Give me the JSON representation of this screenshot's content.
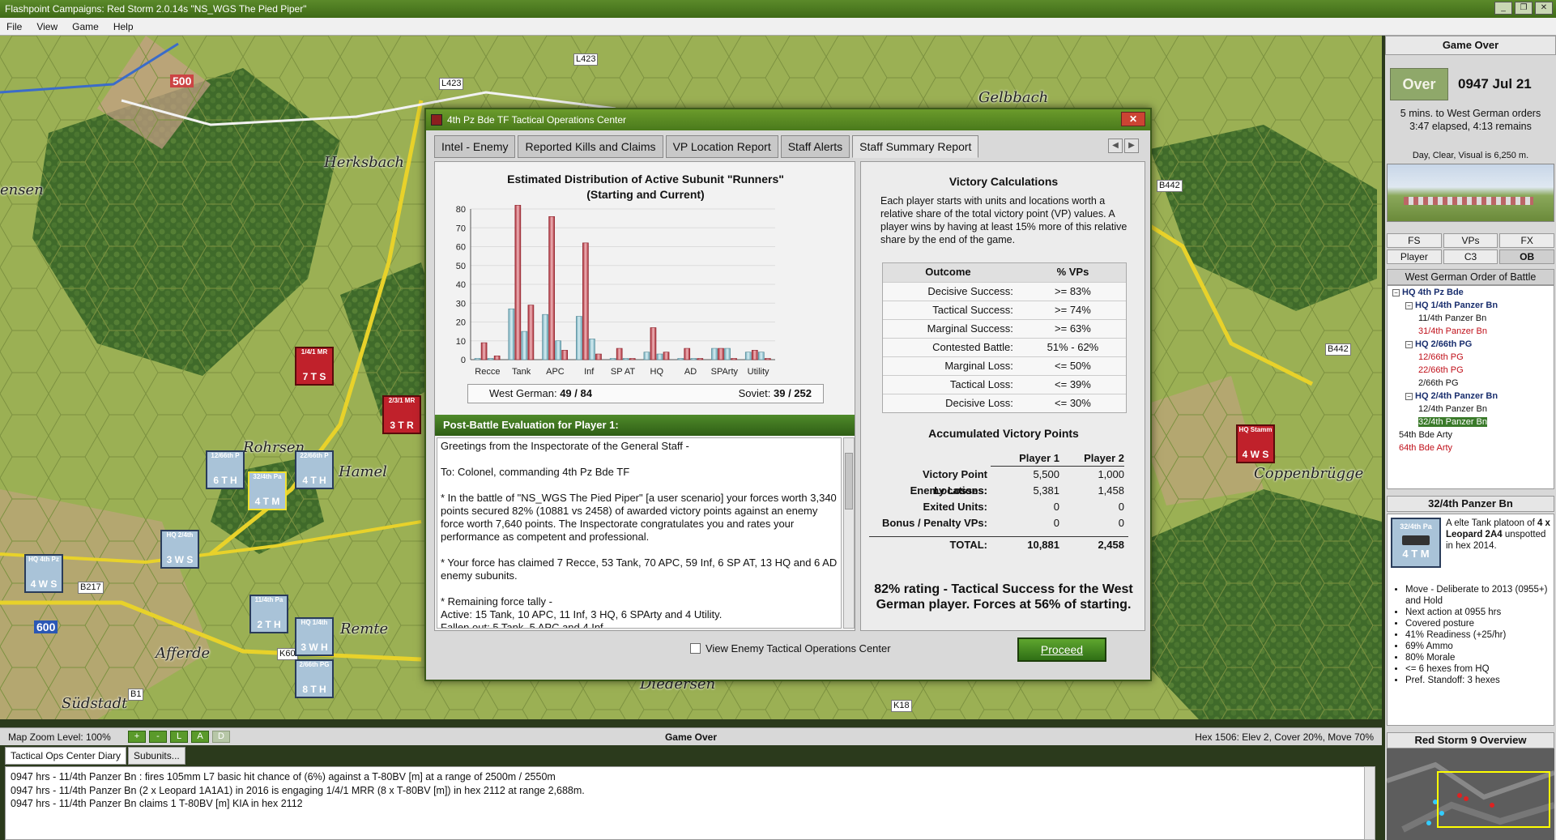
{
  "window": {
    "title": "Flashpoint Campaigns: Red Storm  2.0.14s  \"NS_WGS The Pied Piper\""
  },
  "menu": [
    "File",
    "View",
    "Game",
    "Help"
  ],
  "map": {
    "places": [
      "Herksbach",
      "Gelbbach",
      "Rohrsen",
      "Hamel",
      "Remte",
      "Afferde",
      "Südstadt",
      "Coppenbrügge",
      "ensen",
      "Diedersen"
    ],
    "roads": [
      "L423",
      "L423",
      "B442",
      "B442",
      "B217",
      "B1",
      "K60",
      "K18"
    ],
    "vp_markers": [
      "500",
      "600"
    ],
    "counters": [
      {
        "top": "1/4/1 MR",
        "bottom": "7 T S",
        "side": "red"
      },
      {
        "top": "2/3/1 MR",
        "bottom": "3 T R",
        "side": "red"
      },
      {
        "top": "12/66th P",
        "bottom": "6 T H",
        "side": "blue"
      },
      {
        "top": "32/4th Pa",
        "bottom": "4 T M",
        "side": "blue"
      },
      {
        "top": "22/66th P",
        "bottom": "4 T H",
        "side": "blue"
      },
      {
        "top": "HQ 2/4th",
        "bottom": "3 W S",
        "side": "blue"
      },
      {
        "top": "HQ 4th Pz",
        "bottom": "4 W S",
        "side": "blue"
      },
      {
        "top": "11/4th Pa",
        "bottom": "2 T H",
        "side": "blue"
      },
      {
        "top": "HQ 1/4th",
        "bottom": "3 W H",
        "side": "blue"
      },
      {
        "top": "2/66th PG",
        "bottom": "8 T H",
        "side": "blue"
      },
      {
        "top": "HQ Stamm",
        "bottom": "4 W S",
        "side": "red"
      }
    ]
  },
  "dialog": {
    "title": "4th Pz Bde TF Tactical Operations Center",
    "tabs": [
      "Intel - Enemy",
      "Reported Kills and Claims",
      "VP Location Report",
      "Staff Alerts",
      "Staff Summary Report"
    ],
    "active_tab": "Staff Summary Report",
    "chart_title_1": "Estimated Distribution of Active Subunit \"Runners\"",
    "chart_title_2": "(Starting and Current)",
    "summary": {
      "west_label": "West German:",
      "west_value": "49 / 84",
      "soviet_label": "Soviet:",
      "soviet_value": "39 / 252"
    },
    "eval_header": "Post-Battle Evaluation for Player 1:",
    "eval_paragraphs": [
      "Greetings from the Inspectorate of the General Staff -",
      "To: Colonel, commanding 4th Pz Bde TF",
      "* In the battle of \"NS_WGS The Pied Piper\" [a user scenario] your forces worth 3,340 points secured 82% (10881 vs 2458) of awarded victory points against an enemy force worth 7,640 points.  The Inspectorate congratulates you and rates your performance as competent and professional.",
      "* Your force has claimed 7 Recce, 53 Tank, 70 APC, 59 Inf, 6 SP AT, 13 HQ and 6 AD enemy subunits.",
      "* Remaining force tally -\n  Active: 15 Tank, 10 APC, 11 Inf, 3 HQ, 6 SPArty and 4 Utility.\n  Fallen out: 5 Tank, 5 APC and 4 Inf."
    ],
    "victory_title": "Victory Calculations",
    "victory_text": "Each player starts with units and locations worth a relative share of the total victory point (VP) values. A player wins by having at least 15% more of this relative share by the end of the game.",
    "outcome_header": [
      "Outcome",
      "% VPs"
    ],
    "outcomes": [
      [
        "Decisive Success:",
        ">= 83%"
      ],
      [
        "Tactical Success:",
        ">= 74%"
      ],
      [
        "Marginal Success:",
        ">= 63%"
      ],
      [
        "Contested Battle:",
        "51% - 62%"
      ],
      [
        "Marginal Loss:",
        "<= 50%"
      ],
      [
        "Tactical Loss:",
        "<= 39%"
      ],
      [
        "Decisive Loss:",
        "<= 30%"
      ]
    ],
    "accum_title": "Accumulated Victory Points",
    "accum_header": [
      "",
      "Player 1",
      "Player 2"
    ],
    "accum_rows": [
      [
        "Victory Point Locations:",
        "5,500",
        "1,000"
      ],
      [
        "Enemy Losses:",
        "5,381",
        "1,458"
      ],
      [
        "Exited Units:",
        "0",
        "0"
      ],
      [
        "Bonus / Penalty VPs:",
        "0",
        "0"
      ]
    ],
    "total_row": [
      "TOTAL:",
      "10,881",
      "2,458"
    ],
    "rating_text": "82% rating - Tactical Success for the West German player.  Forces at 56% of starting.",
    "view_enemy_label": "View Enemy Tactical Operations Center",
    "proceed_label": "Proceed"
  },
  "chart_data": {
    "type": "bar",
    "title": "Estimated Distribution of Active Subunit \"Runners\" (Starting and Current)",
    "categories": [
      "Recce",
      "Tank",
      "APC",
      "Inf",
      "SP AT",
      "HQ",
      "AD",
      "SPArty",
      "Utility"
    ],
    "series": [
      {
        "name": "West German",
        "start": [
          0,
          27,
          24,
          23,
          0,
          4,
          0,
          6,
          4
        ],
        "current": [
          0,
          15,
          10,
          11,
          0,
          3,
          0,
          6,
          4
        ]
      },
      {
        "name": "Soviet",
        "start": [
          9,
          82,
          76,
          62,
          6,
          17,
          6,
          6,
          5
        ],
        "current": [
          2,
          29,
          5,
          3,
          0,
          4,
          0,
          0,
          0
        ]
      }
    ],
    "ylim": [
      0,
      80
    ],
    "yticks": [
      0,
      10,
      20,
      30,
      40,
      50,
      60,
      70,
      80
    ],
    "colors": {
      "west": "#8fc3cf",
      "soviet": "#c4434d"
    }
  },
  "right_panel": {
    "header": "Game Over",
    "over_button": "Over",
    "time": "0947 Jul 21",
    "orders_line1": "5 mins. to West German orders",
    "orders_line2": "3:47 elapsed, 4:13 remains",
    "weather": "Day, Clear, Visual is 6,250 m.",
    "buttons": [
      "FS",
      "VPs",
      "FX",
      "Player",
      "C3",
      "OB"
    ],
    "active_button": "OB",
    "ob_header": "West German Order of Battle",
    "ob_tree": [
      {
        "label": "HQ 4th Pz Bde",
        "style": "b",
        "indent": 0,
        "toggle": "−"
      },
      {
        "label": "HQ 1/4th Panzer Bn",
        "style": "b",
        "indent": 1,
        "toggle": "−"
      },
      {
        "label": "11/4th Panzer Bn",
        "style": "",
        "indent": 2,
        "toggle": ""
      },
      {
        "label": "31/4th Panzer Bn",
        "style": "r",
        "indent": 2,
        "toggle": ""
      },
      {
        "label": "HQ 2/66th PG",
        "style": "b",
        "indent": 1,
        "toggle": "−"
      },
      {
        "label": "12/66th PG",
        "style": "r",
        "indent": 2,
        "toggle": ""
      },
      {
        "label": "22/66th PG",
        "style": "r",
        "indent": 2,
        "toggle": ""
      },
      {
        "label": "2/66th PG",
        "style": "",
        "indent": 2,
        "toggle": ""
      },
      {
        "label": "HQ 2/4th Panzer Bn",
        "style": "b",
        "indent": 1,
        "toggle": "−"
      },
      {
        "label": "12/4th Panzer Bn",
        "style": "",
        "indent": 2,
        "toggle": ""
      },
      {
        "label": "32/4th Panzer Bn",
        "style": "sel",
        "indent": 2,
        "toggle": ""
      },
      {
        "label": "54th Bde Arty",
        "style": "",
        "indent": 0.5,
        "toggle": ""
      },
      {
        "label": "64th Bde Arty",
        "style": "r",
        "indent": 0.5,
        "toggle": ""
      }
    ],
    "unit_header": "32/4th Panzer Bn",
    "unit_icon_top": "32/4th Pa",
    "unit_icon_bottom": "4 T M",
    "unit_desc_1": "A elte Tank platoon of",
    "unit_desc_2": "4 x Leopard 2A4",
    "unit_desc_3": "unspotted in hex 2014.",
    "unit_list": [
      "Move - Deliberate to 2013 (0955+) and Hold",
      "Next action at 0955 hrs",
      "Covered posture",
      "41% Readiness (+25/hr)",
      "69% Ammo",
      "80% Morale",
      "<= 6 hexes from HQ",
      "Pref. Standoff: 3 hexes"
    ],
    "overview_header": "Red Storm 9 Overview"
  },
  "status": {
    "zoom": "Map Zoom Level: 100%",
    "zoom_buttons": [
      "+",
      "-",
      "L",
      "A",
      "D"
    ],
    "center": "Game Over",
    "hex_info": "Hex 1506: Elev 2, Cover 20%, Move 70%"
  },
  "log": {
    "tabs": [
      "Tactical Ops Center Diary",
      "Subunits..."
    ],
    "lines": [
      "0947 hrs - 11/4th Panzer Bn : fires 105mm L7 basic hit chance of (6%) against a T-80BV [m] at a range of 2500m / 2550m",
      "0947 hrs - 11/4th Panzer Bn (2 x Leopard 1A1A1) in 2016 is engaging 1/4/1 MRR (8 x T-80BV [m]) in hex 2112 at range 2,688m.",
      "0947 hrs - 11/4th Panzer Bn claims 1 T-80BV [m] KIA in hex 2112"
    ]
  }
}
